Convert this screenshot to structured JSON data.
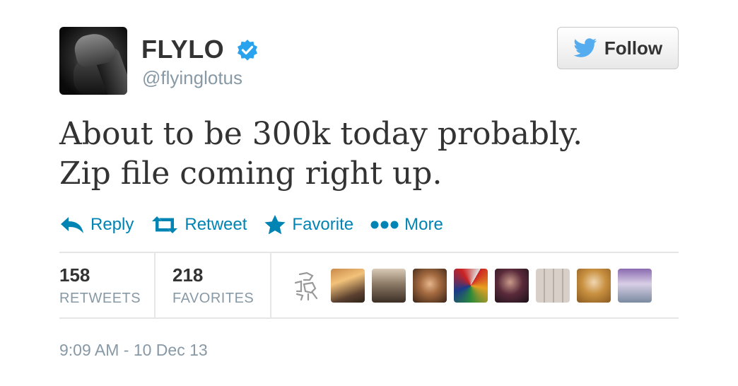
{
  "user": {
    "name": "FLYLO",
    "handle": "@flyinglotus",
    "verified": true
  },
  "follow_button": {
    "label": "Follow"
  },
  "tweet": {
    "lines": [
      "About to be 300k today probably.",
      "Zip file coming right up."
    ]
  },
  "actions": {
    "reply": "Reply",
    "retweet": "Retweet",
    "favorite": "Favorite",
    "more": "More"
  },
  "stats": {
    "retweets": {
      "count": "158",
      "label": "RETWEETS"
    },
    "favorites": {
      "count": "218",
      "label": "FAVORITES"
    }
  },
  "timestamp": "9:09 AM - 10 Dec 13",
  "colors": {
    "link": "#0084b4",
    "verified": "#2aa3ef",
    "twitter_bird": "#55acee",
    "muted": "#8899a6"
  },
  "icons": {
    "follow": "twitter-bird-icon",
    "verified": "verified-badge-icon",
    "reply": "reply-arrow-icon",
    "retweet": "retweet-icon",
    "favorite": "star-icon",
    "more": "more-dots-icon"
  }
}
